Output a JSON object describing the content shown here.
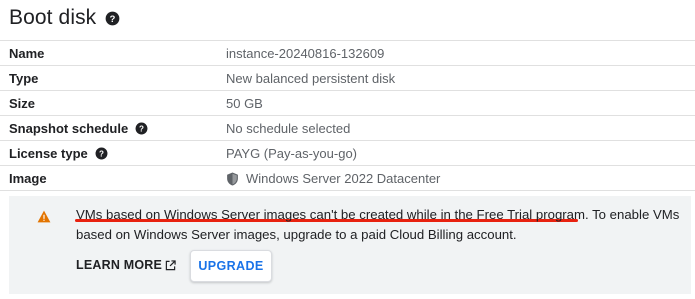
{
  "section": {
    "title": "Boot disk"
  },
  "details": [
    {
      "label": "Name",
      "value": "instance-20240816-132609",
      "help": false,
      "icon": null
    },
    {
      "label": "Type",
      "value": "New balanced persistent disk",
      "help": false,
      "icon": null
    },
    {
      "label": "Size",
      "value": "50 GB",
      "help": false,
      "icon": null
    },
    {
      "label": "Snapshot schedule",
      "value": "No schedule selected",
      "help": true,
      "icon": null
    },
    {
      "label": "License type",
      "value": "PAYG (Pay-as-you-go)",
      "help": true,
      "icon": null
    },
    {
      "label": "Image",
      "value": "Windows Server 2022 Datacenter",
      "help": false,
      "icon": "shield-icon"
    }
  ],
  "alert": {
    "icon": "warning-icon",
    "message_line1": "VMs based on Windows Server images can't be created while in the Free Trial program. To enable VMs",
    "message_line2": "based on Windows Server images, upgrade to a paid Cloud Billing account.",
    "learn_more_label": "LEARN MORE",
    "upgrade_label": "UPGRADE",
    "highlight_color": "#e8210f",
    "warning_color": "#e37400"
  },
  "colors": {
    "accent": "#1a73e8",
    "text_primary": "#202124",
    "text_secondary": "#5f6368",
    "alert_background": "#f1f3f4"
  }
}
